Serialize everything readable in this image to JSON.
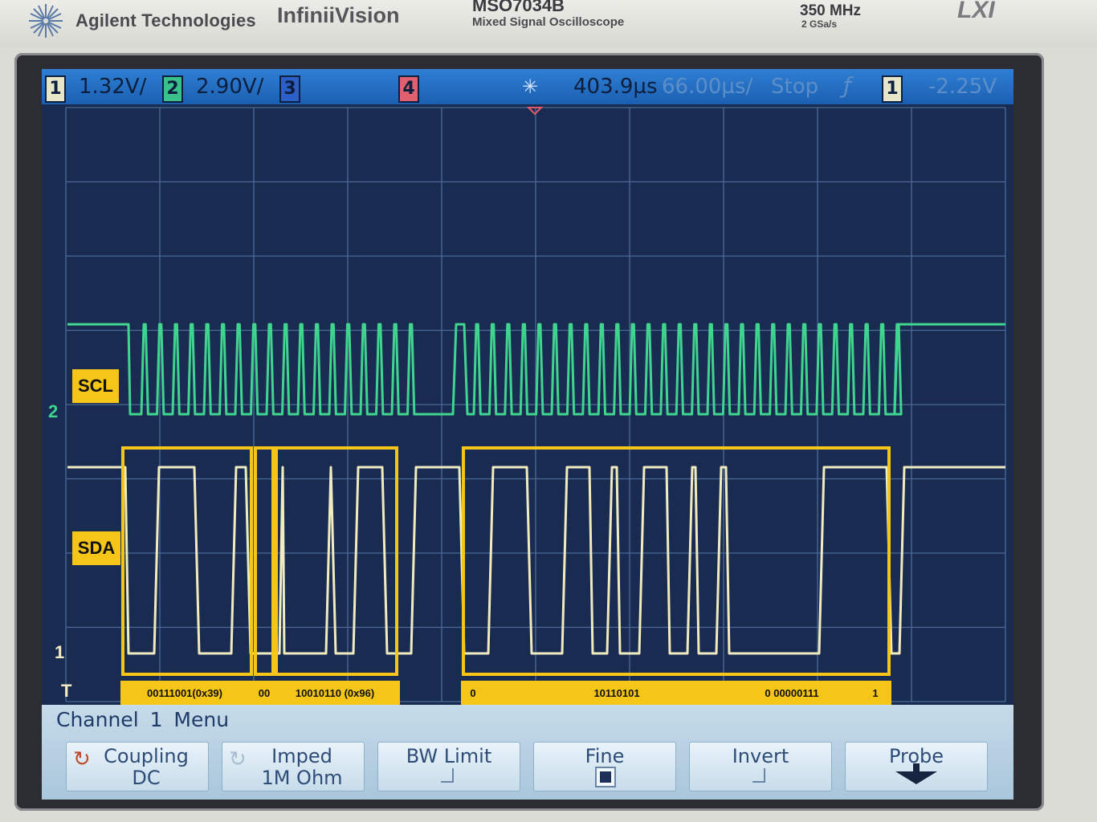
{
  "header": {
    "brand": "Agilent Technologies",
    "product": "InfiniiVision",
    "model": "MSO7034B",
    "model_subtitle": "Mixed Signal Oscilloscope",
    "bandwidth": "350 MHz",
    "sample_rate": "2 GSa/s",
    "lxi": "LXI"
  },
  "status_bar": {
    "ch1_num": "1",
    "ch1_scale": "1.32V/",
    "ch2_num": "2",
    "ch2_scale": "2.90V/",
    "ch3_num": "3",
    "ch4_num": "4",
    "time_position": "403.9µs",
    "time_scale": "66.00µs/",
    "run_state": "Stop",
    "trigger_source": "1",
    "trigger_level": "-2.25V"
  },
  "signals": {
    "scl_label": "SCL",
    "sda_label": "SDA",
    "ch2_marker": "2",
    "ch1_marker": "1",
    "trigger_marker": "T"
  },
  "decode": {
    "segment1": "00111001(0x39)",
    "segment2": "00",
    "segment3": "10010110 (0x96)",
    "segment4_start": "0",
    "segment4_data1": "10110101",
    "segment4_data2": "0 00000111",
    "segment4_end": "1"
  },
  "menu": {
    "title": "Channel 1  Menu",
    "softkeys": [
      {
        "line1": "Coupling",
        "line2": "DC"
      },
      {
        "line1": "Imped",
        "line2": "1M Ohm"
      },
      {
        "line1": "BW Limit",
        "line2": ""
      },
      {
        "line1": "Fine",
        "line2": ""
      },
      {
        "line1": "Invert",
        "line2": ""
      },
      {
        "line1": "Probe",
        "line2": ""
      }
    ]
  },
  "colors": {
    "scl_trace": "#3fd58f",
    "sda_trace": "#f1ecc0",
    "annotation": "#f5c518",
    "grid": "#4b6a98",
    "screen_bg": "#1a2b52"
  },
  "icons": {
    "trigger": "sunburst-trigger-icon",
    "slope": "rising-edge-icon",
    "coupling": "cycle-icon",
    "imped": "cycle-icon",
    "probe": "down-arrow-icon"
  }
}
